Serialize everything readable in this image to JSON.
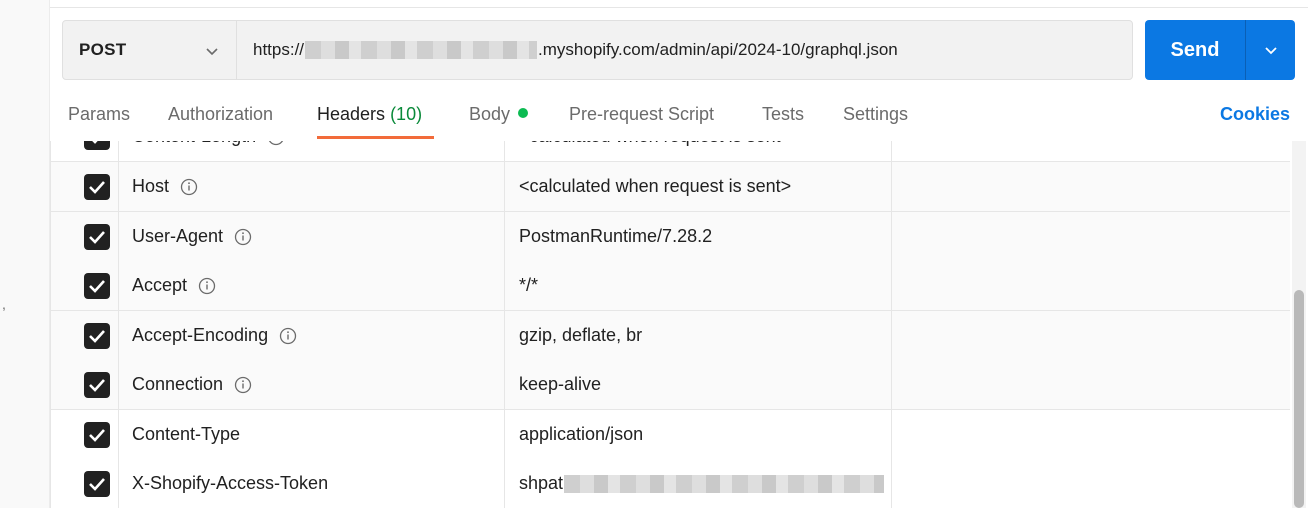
{
  "request": {
    "method": "POST",
    "url_prefix": "https://",
    "url_suffix": ".myshopify.com/admin/api/2024-10/graphql.json"
  },
  "send": {
    "label": "Send"
  },
  "tabs": [
    {
      "label": "Params"
    },
    {
      "label": "Authorization"
    },
    {
      "label": "Headers",
      "count": "(10)",
      "active": true
    },
    {
      "label": "Body"
    },
    {
      "label": "Pre-request Script"
    },
    {
      "label": "Tests"
    },
    {
      "label": "Settings"
    }
  ],
  "cookies_label": "Cookies",
  "gutter_mark": ",",
  "headers": [
    {
      "key": "Content-Length",
      "value": "<calculated when request is sent>",
      "checked": true,
      "info": true
    },
    {
      "key": "Host",
      "value": "<calculated when request is sent>",
      "checked": true,
      "info": true
    },
    {
      "key": "User-Agent",
      "value": "PostmanRuntime/7.28.2",
      "checked": true,
      "info": true
    },
    {
      "key": "Accept",
      "value": "*/*",
      "checked": true,
      "info": true
    },
    {
      "key": "Accept-Encoding",
      "value": "gzip, deflate, br",
      "checked": true,
      "info": true
    },
    {
      "key": "Connection",
      "value": "keep-alive",
      "checked": true,
      "info": true
    },
    {
      "key": "Content-Type",
      "value": "application/json",
      "checked": true,
      "info": false
    },
    {
      "key": "X-Shopify-Access-Token",
      "value": "shpat",
      "checked": true,
      "info": false
    }
  ],
  "colors": {
    "accent": "#0b78e3",
    "active_tab_underline": "#f26b3a",
    "body_dot": "#0cbb52",
    "count_text": "#0a8a3a",
    "checkbox": "#212121"
  }
}
